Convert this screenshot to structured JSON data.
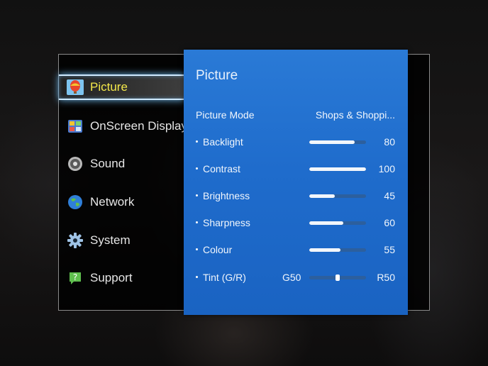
{
  "sidebar": {
    "items": [
      {
        "label": "Picture",
        "icon": "hot-air-balloon-icon",
        "active": true
      },
      {
        "label": "OnScreen Display",
        "icon": "onscreen-display-icon",
        "active": false
      },
      {
        "label": "Sound",
        "icon": "speaker-icon",
        "active": false
      },
      {
        "label": "Network",
        "icon": "globe-icon",
        "active": false
      },
      {
        "label": "System",
        "icon": "gear-icon",
        "active": false
      },
      {
        "label": "Support",
        "icon": "help-bubble-icon",
        "active": false
      }
    ]
  },
  "panel": {
    "title": "Picture",
    "picture_mode": {
      "label": "Picture Mode",
      "value": "Shops & Shoppi..."
    },
    "settings": [
      {
        "label": "Backlight",
        "value": "80",
        "level": 0.8
      },
      {
        "label": "Contrast",
        "value": "100",
        "level": 1.0
      },
      {
        "label": "Brightness",
        "value": "45",
        "level": 0.45
      },
      {
        "label": "Sharpness",
        "value": "60",
        "level": 0.6
      },
      {
        "label": "Colour",
        "value": "55",
        "level": 0.55
      }
    ],
    "tint": {
      "label": "Tint (G/R)",
      "left_value": "G50",
      "right_value": "R50",
      "balance": 0.5
    }
  },
  "colors": {
    "panel_blue": "#1f6ccc",
    "active_label": "#f4e84a",
    "highlight_glow": "#78c8ff"
  }
}
